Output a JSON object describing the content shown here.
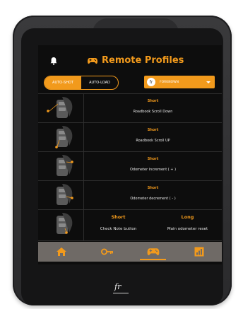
{
  "header": {
    "title": "Remote Profiles",
    "bell_icon": "bell-icon",
    "title_icon": "gamepad-icon"
  },
  "mode_toggle": {
    "options": [
      "AUTO-SHOT",
      "AUTO-LOAD"
    ],
    "selected_index": 0
  },
  "profile_select": {
    "value": "FORKNOWN",
    "avatar_letter": "fr"
  },
  "rows": [
    {
      "press_type": "Short",
      "action": "Roadbook Scroll Down"
    },
    {
      "press_type": "Short",
      "action": "Roadbook Scroll UP"
    },
    {
      "press_type": "Short",
      "action": "Odometer increment ( + )"
    },
    {
      "press_type": "Short",
      "action": "Odometer decrement ( - )"
    },
    {
      "short": {
        "press_type": "Short",
        "action": "Check Note button"
      },
      "long": {
        "press_type": "Long",
        "action": "Main odometer reset"
      }
    }
  ],
  "tabs": [
    {
      "icon": "home-icon",
      "active": false
    },
    {
      "icon": "key-icon",
      "active": false
    },
    {
      "icon": "gamepad-icon",
      "active": true
    },
    {
      "icon": "chart-icon",
      "active": false
    }
  ],
  "brand": "fr",
  "colors": {
    "accent": "#f29a1c",
    "screen_bg": "#0d0d0d",
    "tabbar_bg": "#6f6a66",
    "device": "#2c2c2e"
  }
}
